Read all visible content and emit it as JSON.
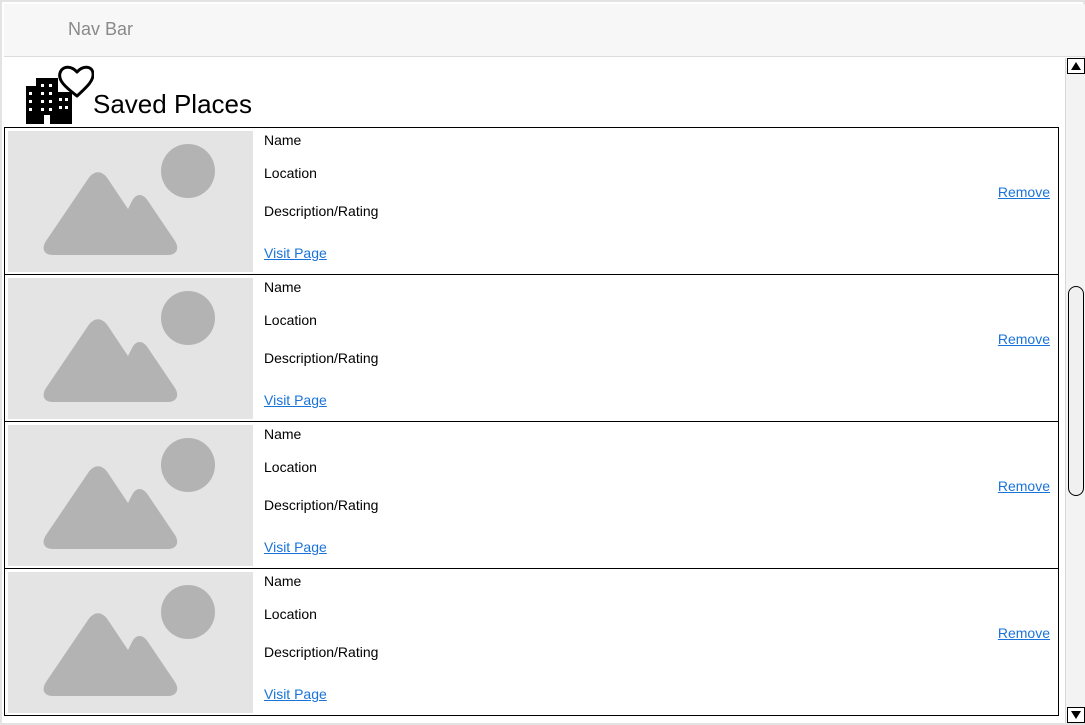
{
  "navbar": {
    "label": "Nav Bar"
  },
  "header": {
    "title": "Saved Places",
    "icon": "city-heart-icon"
  },
  "places": [
    {
      "name": "Name",
      "location": "Location",
      "description": "Description/Rating",
      "visit_label": "Visit Page",
      "remove_label": "Remove"
    },
    {
      "name": "Name",
      "location": "Location",
      "description": "Description/Rating",
      "visit_label": "Visit Page",
      "remove_label": "Remove"
    },
    {
      "name": "Name",
      "location": "Location",
      "description": "Description/Rating",
      "visit_label": "Visit Page",
      "remove_label": "Remove"
    },
    {
      "name": "Name",
      "location": "Location",
      "description": "Description/Rating",
      "visit_label": "Visit Page",
      "remove_label": "Remove"
    }
  ],
  "colors": {
    "link": "#1a73d9",
    "placeholder_bg": "#e4e4e4",
    "placeholder_shape": "#b3b3b3",
    "navbar_bg": "#f7f7f7"
  }
}
